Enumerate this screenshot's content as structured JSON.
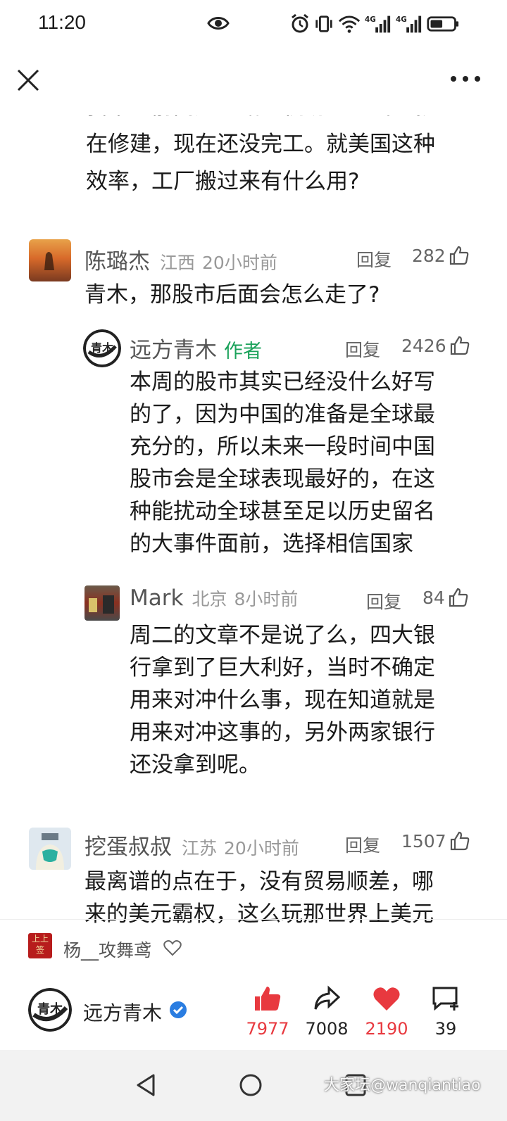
{
  "status_bar": {
    "time": "11:20",
    "net_4g_a": "4G",
    "net_4g_b": "4G"
  },
  "top_nav": {
    "close_icon": "close-icon",
    "more_icon": "more-dots-icon"
  },
  "partial_text": "我来之前高速公路到机场一个出口就\n在修建，现在还没完工。就美国这种\n效率，工厂搬过来有什么用?",
  "comments": [
    {
      "name": "陈璐杰",
      "location": "江西",
      "time": "20小时前",
      "reply": "回复",
      "likes": "282",
      "body": "青木，那股市后面会怎么走了?"
    },
    {
      "name": "远方青木",
      "author_badge": "作者",
      "reply": "回复",
      "likes": "2426",
      "body": "本周的股市其实已经没什么好写\n的了，因为中国的准备是全球最\n充分的，所以未来一段时间中国\n股市会是全球表现最好的，在这\n种能扰动全球甚至足以历史留名\n的大事件面前，选择相信国家"
    },
    {
      "name": "Mark",
      "location": "北京",
      "time": "8小时前",
      "reply": "回复",
      "likes": "84",
      "body": "周二的文章不是说了么，四大银\n行拿到了巨大利好，当时不确定\n用来对冲什么事，现在知道就是\n用来对冲这事的，另外两家银行\n还没拿到呢。"
    },
    {
      "name": "挖蛋叔叔",
      "location": "江苏",
      "time": "20小时前",
      "reply": "回复",
      "likes": "1507",
      "body": "最离谱的点在于，没有贸易顺差，哪\n来的美元霸权，这么玩那世界上美元"
    }
  ],
  "tags_bar": {
    "badge_line1": "上上",
    "badge_line2": "签",
    "user": "杨__攻舞鸢"
  },
  "action_bar": {
    "author": "远方青木",
    "likes": "7977",
    "shares": "7008",
    "favorites": "2190",
    "comments": "39",
    "accent": "#e8393f"
  },
  "nav_bar": {
    "watermark": "大家坛@wanqiantiao"
  }
}
